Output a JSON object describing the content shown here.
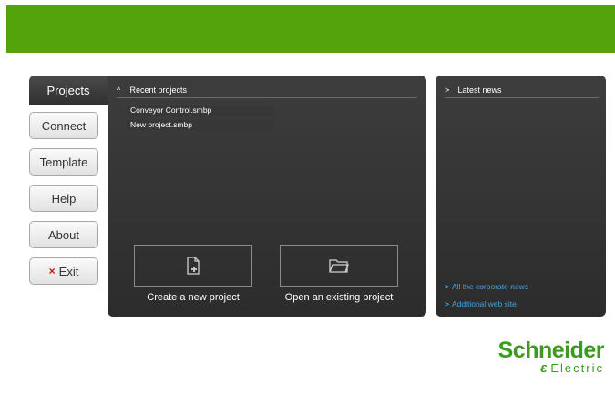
{
  "nav": {
    "active_tab": "Projects",
    "buttons": [
      "Connect",
      "Template",
      "Help",
      "About"
    ],
    "exit_label": "Exit",
    "exit_icon": "×"
  },
  "recent": {
    "heading": "Recent projects",
    "chevron": "^",
    "items": [
      "Conveyor Control.smbp",
      "New project.smbp"
    ]
  },
  "actions": {
    "create_label": "Create a new project",
    "open_label": "Open an existing project"
  },
  "news": {
    "heading": "Latest news",
    "chevron": ">",
    "links": [
      "All the corporate news",
      "Additional web site"
    ]
  },
  "logo": {
    "line1": "Schneider",
    "line2": "Electric",
    "mark": "ɛ"
  },
  "colors": {
    "brand_green": "#55a30a",
    "link_blue": "#3ea6e8",
    "exit_red": "#d01010"
  }
}
